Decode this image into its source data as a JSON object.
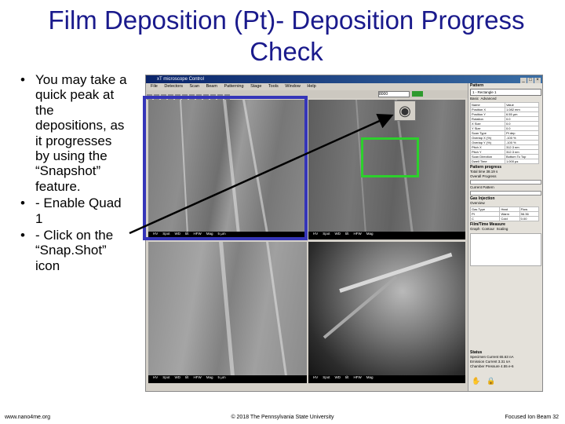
{
  "slide": {
    "title": "Film Deposition (Pt)- Deposition Progress Check",
    "bullets": [
      "You may take a quick peak at the depositions, as it progresses by using the “Snapshot” feature.",
      "- Enable Quad 1",
      "- Click on the “Snap.Shot” icon"
    ],
    "footer_left": "www.nano4me.org",
    "footer_center": "© 2018 The Pennsylvania State University",
    "footer_right": "Focused Ion Beam 32",
    "title_color": "#1a1a8c",
    "highlight_box_color": "#3535b8",
    "target_box_color": "#2cd02c"
  },
  "app": {
    "window_title": "xT microscope Control",
    "menu": [
      "File",
      "Detectors",
      "Scan",
      "Beam",
      "Patterning",
      "Stage",
      "Tools",
      "Window",
      "Help"
    ],
    "mag_value": "8000",
    "camera_icon": "camera-icon",
    "databar_fields": [
      "HV",
      "Spot",
      "WD",
      "tilt",
      "HFW",
      "Mag"
    ],
    "databar_scale": "5 µm",
    "panel": {
      "pattern_header": "Pattern",
      "pattern_select": "1 - Rectangle 1",
      "tabs": [
        "Basic",
        "Advanced"
      ],
      "properties": [
        [
          "Name",
          "Value"
        ],
        [
          "Position X",
          "1.082 mm"
        ],
        [
          "Position Y",
          "6.55 µm"
        ],
        [
          "Rotation",
          "0.0"
        ],
        [
          "X Size",
          "0.0"
        ],
        [
          "Y Size",
          "0.0"
        ],
        [
          "Scan Type",
          "Pt dep"
        ],
        [
          "Overlap X (%)",
          "-100 %"
        ],
        [
          "Overlap Y (%)",
          "-100 %"
        ],
        [
          "Pitch X",
          "312.3 nm"
        ],
        [
          "Pitch Y",
          "312.3 nm"
        ],
        [
          "Scan Direction",
          "Bottom To Top"
        ],
        [
          "Dwell Time",
          "1.000 µs"
        ]
      ],
      "progress_header": "Pattern progress",
      "total_time": "Total time 38.19 s",
      "overall_progress": "Overall Progress",
      "current_progress": "Current Pattern",
      "gis_header": "Gas Injection",
      "gis_tabs": [
        "Overview"
      ],
      "gis_col_gas": "Gas Type",
      "gis_col_heat": "Heat",
      "gis_col_flow": "Flow",
      "gis_rows": [
        [
          "Pt",
          "Warm",
          "56.36"
        ],
        [
          "C",
          "Cold",
          "0.00"
        ]
      ],
      "tv_header": "Film/Time Measure",
      "tv_tabs": [
        "Graph",
        "Contour",
        "Scaling"
      ],
      "status_header": "Status",
      "status_rows": [
        [
          "Specimen Current",
          "65.63 nA"
        ],
        [
          "Emission Current",
          "3.31 nA"
        ],
        [
          "Chamber Pressure",
          "4.55 e-6"
        ]
      ]
    }
  }
}
